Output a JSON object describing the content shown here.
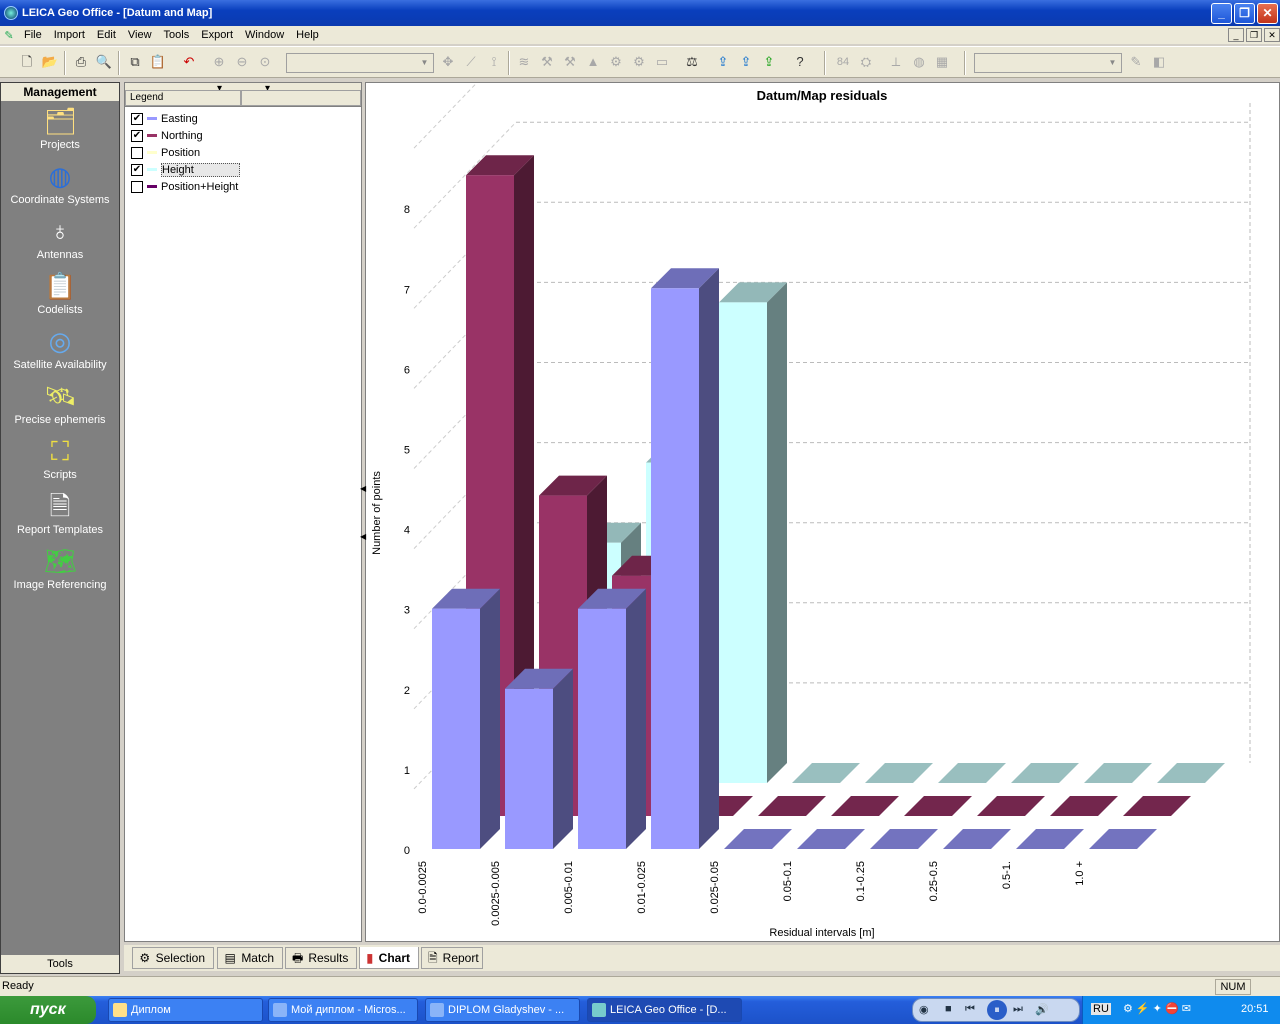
{
  "window": {
    "title": "LEICA Geo Office - [Datum and Map]"
  },
  "menu": [
    "File",
    "Import",
    "Edit",
    "View",
    "Tools",
    "Export",
    "Window",
    "Help"
  ],
  "toolbar": {
    "counter": "84"
  },
  "management": {
    "header": "Management",
    "footer": "Tools",
    "items": [
      "Projects",
      "Coordinate Systems",
      "Antennas",
      "Codelists",
      "Satellite Availability",
      "Precise ephemeris",
      "Scripts",
      "Report Templates",
      "Image Referencing"
    ]
  },
  "legend": {
    "header": "Legend",
    "items": [
      {
        "label": "Easting",
        "checked": true,
        "color": "#9999ff"
      },
      {
        "label": "Northing",
        "checked": true,
        "color": "#993366"
      },
      {
        "label": "Position",
        "checked": false,
        "color": "#ffffcc"
      },
      {
        "label": "Height",
        "checked": true,
        "color": "#ccffff"
      },
      {
        "label": "Position+Height",
        "checked": false,
        "color": "#660066"
      }
    ]
  },
  "tabs": [
    "Selection",
    "Match",
    "Results",
    "Chart",
    "Report"
  ],
  "active_tab": "Chart",
  "status": {
    "text": "Ready",
    "num": "NUM"
  },
  "taskbar": {
    "start": "пуск",
    "tasks": [
      "Диплом",
      "Мой диплом - Micros...",
      "DIPLOM Gladyshev - ...",
      "LEICA Geo Office - [D..."
    ],
    "lang": "RU",
    "clock": "20:51"
  },
  "chart_data": {
    "type": "bar",
    "title": "Datum/Map residuals",
    "xlabel": "Residual intervals [m]",
    "ylabel": "Number of points",
    "ylim": [
      0,
      9
    ],
    "yticks": [
      "0",
      "1",
      "2",
      "3",
      "4",
      "5",
      "6",
      "7",
      "8"
    ],
    "categories": [
      "0.0-0.0025",
      "0.0025-0.005",
      "0.005-0.01",
      "0.01-0.025",
      "0.025-0.05",
      "0.05-0.1",
      "0.1-0.25",
      "0.25-0.5",
      "0.5-1.",
      "1.0 +"
    ],
    "series": [
      {
        "name": "Easting",
        "color": "#9999ff",
        "values": [
          3,
          2,
          3,
          7,
          0,
          0,
          0,
          0,
          0,
          0
        ]
      },
      {
        "name": "Northing",
        "color": "#993366",
        "values": [
          8,
          4,
          3,
          0,
          0,
          0,
          0,
          0,
          0,
          0
        ]
      },
      {
        "name": "Height",
        "color": "#ccffff",
        "values": [
          0,
          3,
          4,
          6,
          0,
          0,
          0,
          0,
          0,
          0
        ]
      }
    ]
  }
}
